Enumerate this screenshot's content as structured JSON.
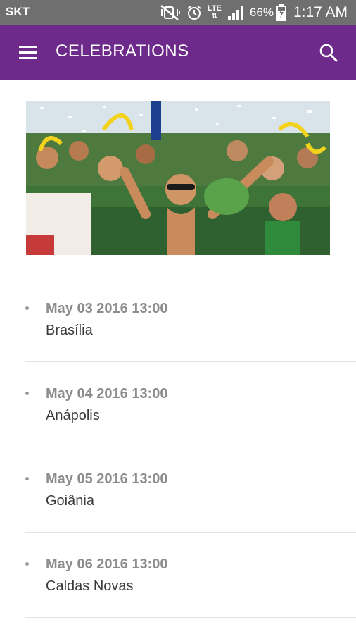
{
  "status_bar": {
    "carrier": "SKT",
    "network": "LTE",
    "battery_percent": "66%",
    "time": "1:17 AM",
    "icons": [
      "mute-vibrate-icon",
      "alarm-icon",
      "lte-icon",
      "signal-icon",
      "battery-charging-icon"
    ]
  },
  "app_bar": {
    "title": "CELEBRATIONS",
    "color": "#6d2a8a",
    "menu_icon": "hamburger-menu-icon",
    "search_icon": "search-icon"
  },
  "events": [
    {
      "date": "May 03 2016 13:00",
      "city": "Brasília"
    },
    {
      "date": "May 04 2016 13:00",
      "city": "Anápolis"
    },
    {
      "date": "May 05 2016 13:00",
      "city": "Goiânia"
    },
    {
      "date": "May 06 2016 13:00",
      "city": "Caldas Novas"
    }
  ]
}
